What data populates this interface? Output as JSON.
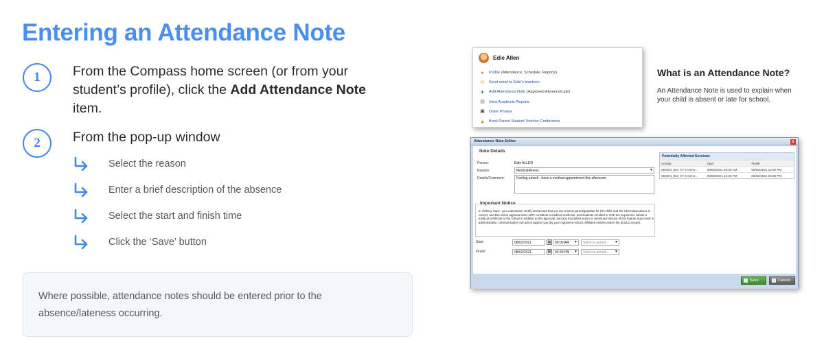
{
  "title": "Entering an Attendance Note",
  "steps": [
    {
      "number": "1",
      "text_before": "From the Compass home screen (or from your student’s profile), click the ",
      "bold": "Add Attendance Note",
      "text_after": " item."
    },
    {
      "number": "2",
      "text": "From the pop-up window"
    }
  ],
  "substeps": [
    "Select the reason",
    "Enter a brief description of the absence",
    "Select the start and finish time",
    "Click the ‘Save’ button"
  ],
  "note": "Where possible, attendance notes should be entered prior to the absence/lateness occurring.",
  "menu": {
    "name": "Edie Allen",
    "items": [
      {
        "label": "Profile",
        "sub": "(Attendance, Schedule, Reports)",
        "icon": "person-icon"
      },
      {
        "label": "Send email to Edie's teachers",
        "sub": "",
        "icon": "email-icon"
      },
      {
        "label": "Add Attendance Note",
        "sub": "(Approved Absence/Late)",
        "icon": "plus-icon"
      },
      {
        "label": "View Academic Reports",
        "sub": "",
        "icon": "report-icon"
      },
      {
        "label": "Order Photos",
        "sub": "",
        "icon": "camera-icon"
      },
      {
        "label": "Book Parent Student Teacher Conference",
        "sub": "",
        "icon": "conference-icon"
      }
    ]
  },
  "side": {
    "title": "What is an Attendance Note?",
    "text": "An Attendance Note is used to explain when your child is absent or late for school."
  },
  "editor": {
    "title": "Attendance Note Editor",
    "close": "x",
    "details_legend": "Note Details",
    "person_label": "Person:",
    "person_value": "Edie ALLEN",
    "reason_label": "Reason:",
    "reason_value": "Medical/Illness",
    "comment_label": "Details/Comment:",
    "comment_value": "Feeling unwell - have a medical appointment this afternoon",
    "notice_legend": "Important Notice",
    "notice_text": "In clicking 'Save', you understand, certify and accept that you are a listed parent/guardian for this child; and the information above is correct; and this online approval does NOT constitute a medical certificate; and students enrolled in VCE are required to submit a medical certificate to the school in addition to this approval; and any fraudulent action or intentional misuse of this feature may result in administrative, criminal and/or civil action against you (by your registered school, affiliated entities and/or the product issuer).",
    "start_label": "Start:",
    "start_date": "08/02/2021",
    "start_time": "09:00 AM",
    "finish_label": "Finish:",
    "finish_date": "08/02/2021",
    "finish_time": "03:30 PM",
    "period_placeholder": "Select a period...",
    "sessions_title": "Potentially Affected Sessions",
    "sessions_headers": [
      "Activity",
      "Start",
      "Finish"
    ],
    "sessions": [
      [
        "05GEN_05A (Yr 5 Gene...",
        "08/02/2021 09:00 AM",
        "08/02/2021 12:00 PM"
      ],
      [
        "05GEN_05A (Yr 5 Gene...",
        "08/02/2021 12:30 PM",
        "08/02/2021 03:30 PM"
      ]
    ],
    "save_label": "Save",
    "cancel_label": "Cancel"
  },
  "colors": {
    "accent": "#4a8ef0",
    "save": "#3d8e2b"
  }
}
